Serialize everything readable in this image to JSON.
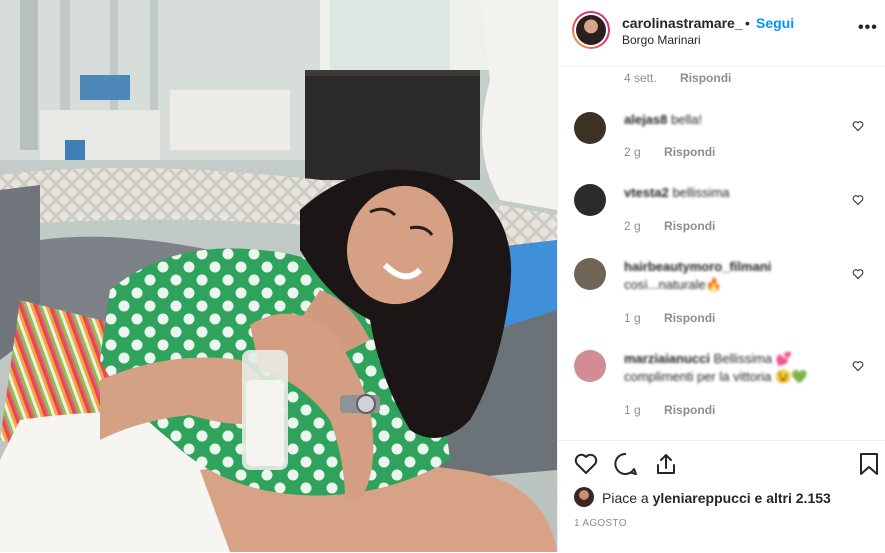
{
  "post": {
    "username": "carolinastramare_",
    "separator": "•",
    "follow_label": "Segui",
    "location": "Borgo Marinari",
    "more_icon": "more-horizontal-icon"
  },
  "previous_comment_meta": {
    "time": "4 sett.",
    "reply": "Rispondi"
  },
  "comments": [
    {
      "author": "alejas8",
      "text": "bella!",
      "time": "2 g",
      "reply": "Rispondi",
      "avatar_color": "#3b3124"
    },
    {
      "author": "vtesta2",
      "text": "bellissima",
      "time": "2 g",
      "reply": "Rispondi",
      "avatar_color": "#2b2b2b"
    },
    {
      "author": "hairbeautymoro_filmani",
      "text": "così...naturale🔥",
      "time": "1 g",
      "reply": "Rispondi",
      "avatar_color": "#6f6455"
    },
    {
      "author": "marziaianucci",
      "text": "Bellissima 💕 complimenti per la vittoria 😉💚",
      "time": "1 g",
      "reply": "Rispondi",
      "avatar_color": "#d38b94"
    }
  ],
  "actions": {
    "like_icon": "heart-icon",
    "comment_icon": "comment-icon",
    "share_icon": "share-icon",
    "save_icon": "bookmark-icon"
  },
  "likes": {
    "prefix": "Piace a ",
    "user": "yleniareppucci",
    "suffix": " e altri 2.153"
  },
  "date": "1 AGOSTO",
  "colors": {
    "accent": "#0095f6",
    "text": "#262626",
    "muted": "#8e8e8e",
    "border": "#efefef"
  }
}
